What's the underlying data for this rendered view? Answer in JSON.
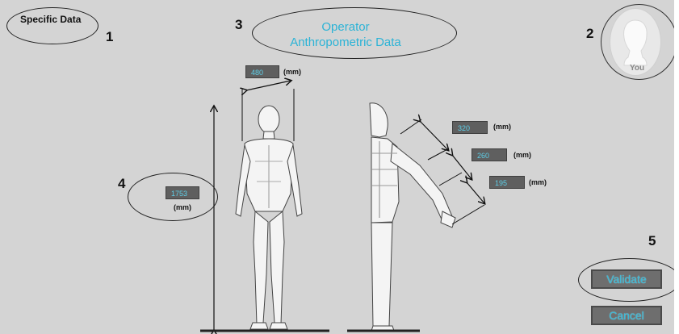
{
  "screen_label": "Specific Data",
  "markers": {
    "m1": "1",
    "m2": "2",
    "m3": "3",
    "m4": "4",
    "m5": "5"
  },
  "title": {
    "line1": "Operator",
    "line2": "Anthropometric Data"
  },
  "user": {
    "label": "You"
  },
  "measurements": {
    "shoulder_width": {
      "value": "480",
      "unit": "(mm)"
    },
    "upper_arm": {
      "value": "320",
      "unit": "(mm)"
    },
    "forearm": {
      "value": "260",
      "unit": "(mm)"
    },
    "hand": {
      "value": "195",
      "unit": "(mm)"
    },
    "height": {
      "value": "1753",
      "unit": "(mm)"
    }
  },
  "buttons": {
    "validate": "Validate",
    "cancel": "Cancel"
  },
  "colors": {
    "background": "#d4d4d4",
    "accent": "#2bb3d6",
    "field_bg": "#5f5f5f"
  }
}
